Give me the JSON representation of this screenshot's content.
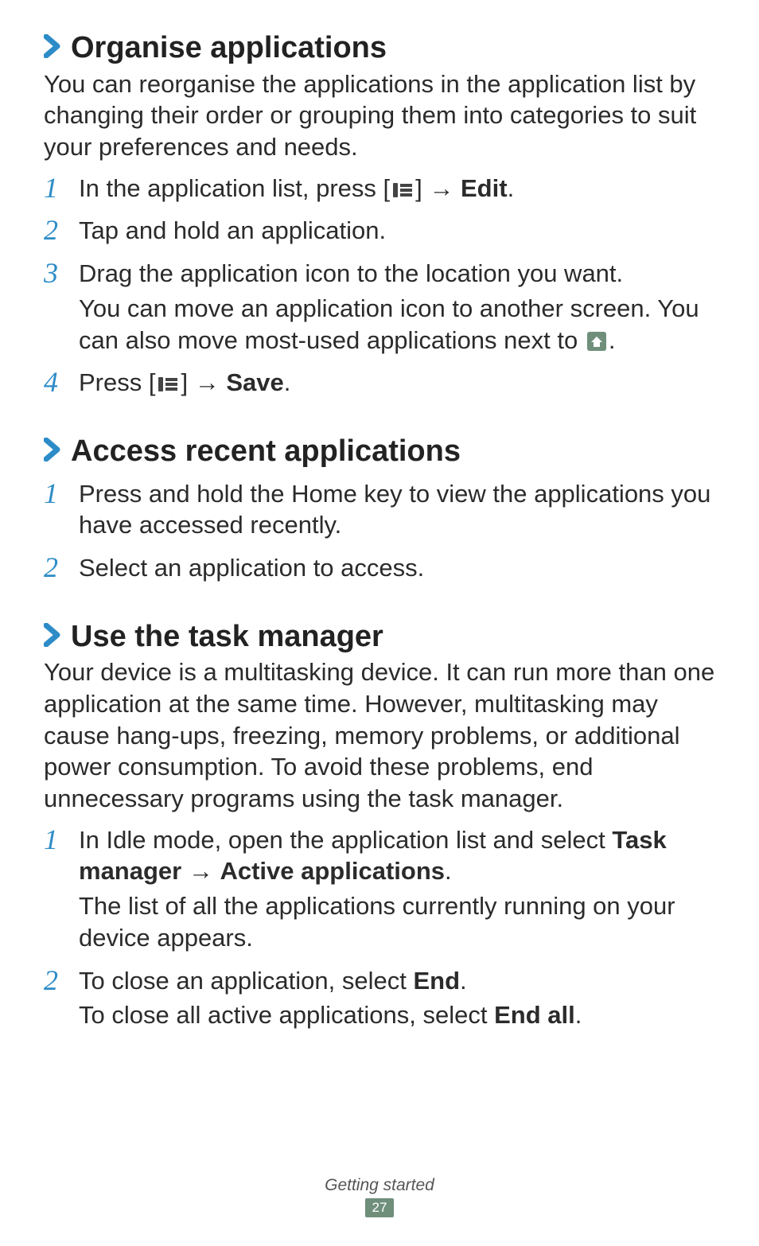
{
  "sections": {
    "organise": {
      "heading": "Organise applications",
      "intro": "You can reorganise the applications in the application list by changing their order or grouping them into categories to suit your preferences and needs.",
      "steps": {
        "s1_pre": "In the application list, press [",
        "s1_post": "] → ",
        "s1_bold": "Edit",
        "s1_end": ".",
        "s2": "Tap and hold an application.",
        "s3a": "Drag the application icon to the location you want.",
        "s3b_pre": "You can move an application icon to another screen. You can also move most-used applications next to ",
        "s3b_post": ".",
        "s4_pre": "Press [",
        "s4_post": "] → ",
        "s4_bold": "Save",
        "s4_end": "."
      },
      "nums": {
        "n1": "1",
        "n2": "2",
        "n3": "3",
        "n4": "4"
      }
    },
    "recent": {
      "heading": "Access recent applications",
      "steps": {
        "s1": "Press and hold the Home key to view the applications you have accessed recently.",
        "s2": "Select an application to access."
      },
      "nums": {
        "n1": "1",
        "n2": "2"
      }
    },
    "task": {
      "heading": "Use the task manager",
      "intro": "Your device is a multitasking device. It can run more than one application at the same time. However, multitasking may cause hang-ups, freezing, memory problems, or additional power consumption. To avoid these problems, end unnecessary programs using the task manager.",
      "steps": {
        "s1a_pre": "In Idle mode, open the application list and select ",
        "s1a_b1": "Task manager",
        "s1a_mid": " → ",
        "s1a_b2": "Active applications",
        "s1a_end": ".",
        "s1b": "The list of all the applications currently running on your device appears.",
        "s2a_pre": "To close an application, select ",
        "s2a_b": "End",
        "s2a_end": ".",
        "s2b_pre": "To close all active applications, select ",
        "s2b_b": "End all",
        "s2b_end": "."
      },
      "nums": {
        "n1": "1",
        "n2": "2"
      }
    }
  },
  "footer": {
    "section_label": "Getting started",
    "page_number": "27"
  }
}
